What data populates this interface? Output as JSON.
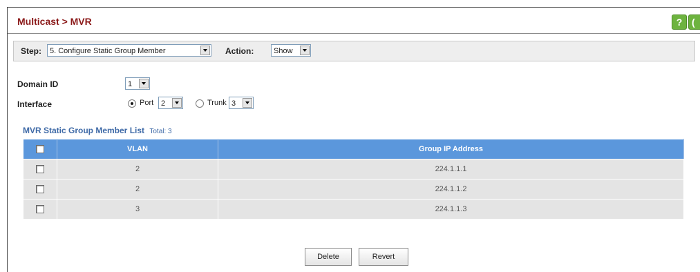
{
  "header": {
    "title": "Multicast > MVR",
    "help_icon": "?",
    "other_icon": "("
  },
  "stepbar": {
    "step_label": "Step:",
    "step_value": "5. Configure Static Group Member",
    "action_label": "Action:",
    "action_value": "Show"
  },
  "form": {
    "domain_label": "Domain ID",
    "domain_value": "1",
    "interface_label": "Interface",
    "port_label": "Port",
    "port_value": "2",
    "trunk_label": "Trunk",
    "trunk_value": "3",
    "interface_selected": "port"
  },
  "list": {
    "title": "MVR Static Group Member List",
    "total": "Total: 3",
    "columns": [
      "VLAN",
      "Group IP Address"
    ],
    "rows": [
      {
        "vlan": "2",
        "ip": "224.1.1.1"
      },
      {
        "vlan": "2",
        "ip": "224.1.1.2"
      },
      {
        "vlan": "3",
        "ip": "224.1.1.3"
      }
    ]
  },
  "buttons": {
    "delete": "Delete",
    "revert": "Revert"
  },
  "colors": {
    "title": "#8b1a1a",
    "table_header": "#5b97dc",
    "section_title": "#3f6aa7",
    "help_icon": "#6db33f"
  }
}
